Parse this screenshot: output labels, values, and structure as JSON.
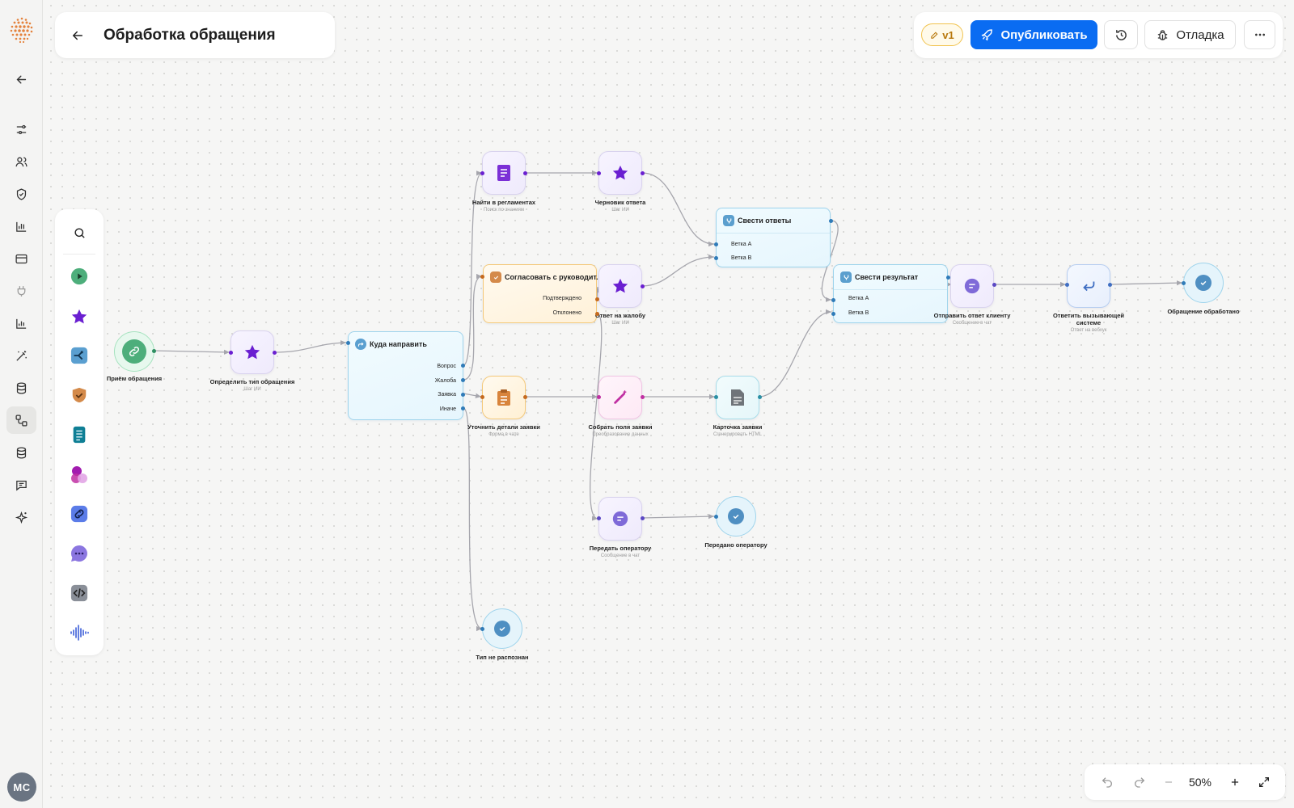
{
  "app": {
    "title": "Обработка обращения",
    "avatar_initials": "MC"
  },
  "toolbar": {
    "version": "v1",
    "publish": "Опубликовать",
    "history_icon": "history-icon",
    "debug": "Отладка",
    "more_icon": "more-icon"
  },
  "sidebar": {
    "items": [
      {
        "icon": "sliders-icon"
      },
      {
        "icon": "users-icon"
      },
      {
        "icon": "shield-icon"
      },
      {
        "icon": "bar-chart-icon"
      },
      {
        "icon": "card-icon"
      },
      {
        "icon": "plug-icon"
      },
      {
        "icon": "analytics-icon"
      },
      {
        "icon": "magic-wand-icon"
      },
      {
        "icon": "database-icon"
      },
      {
        "icon": "workflow-icon"
      },
      {
        "icon": "storage-icon"
      },
      {
        "icon": "chat-icon"
      },
      {
        "icon": "sparkle-icon"
      }
    ],
    "active": "workflow-icon"
  },
  "palette": {
    "items": [
      {
        "icon": "search-icon"
      },
      {
        "icon": "play-icon"
      },
      {
        "icon": "ai-star-icon"
      },
      {
        "icon": "branch-icon"
      },
      {
        "icon": "approval-shield-icon"
      },
      {
        "icon": "document-icon"
      },
      {
        "icon": "merge-circles-icon"
      },
      {
        "icon": "link-icon"
      },
      {
        "icon": "message-icon"
      },
      {
        "icon": "code-icon"
      },
      {
        "icon": "voice-icon"
      }
    ]
  },
  "nodes": {
    "n1": {
      "label": "Приём обращения",
      "sub": ""
    },
    "n2": {
      "label": "Определить тип обращения",
      "sub": "Шаг ИИ"
    },
    "router": {
      "title": "Куда направить",
      "outputs": [
        "Вопрос",
        "Жалоба",
        "Заявка",
        "Иначе"
      ]
    },
    "search": {
      "label": "Найти в регламентах",
      "sub": "Поиск по знаниям"
    },
    "draft": {
      "label": "Черновик ответа",
      "sub": "Шаг ИИ"
    },
    "approve": {
      "title": "Согласовать с руководит...",
      "outputs": [
        "Подтверждено",
        "Отклонено"
      ]
    },
    "complaint": {
      "label": "Ответ на жалобу",
      "sub": "Шаг ИИ"
    },
    "merge1": {
      "title": "Свести ответы",
      "inputs": [
        "Ветка A",
        "Ветка B"
      ]
    },
    "merge2": {
      "title": "Свести результат",
      "inputs": [
        "Ветка A",
        "Ветка B"
      ]
    },
    "details": {
      "label": "Уточнить детали заявки",
      "sub": "Форма в чате"
    },
    "collect": {
      "label": "Собрать поля заявки",
      "sub": "Преобразование данных"
    },
    "card": {
      "label": "Карточка заявки",
      "sub": "Сгенерировать HTML"
    },
    "reply": {
      "label": "Отправить ответ клиенту",
      "sub": "Сообщение в чат"
    },
    "webhook": {
      "label": "Ответить вызывающей системе",
      "sub": "Ответ на вебхук"
    },
    "done": {
      "label": "Обращение обработано",
      "sub": ""
    },
    "operator": {
      "label": "Передать оператору",
      "sub": "Сообщение в чат"
    },
    "op_done": {
      "label": "Передано оператору",
      "sub": ""
    },
    "unknown": {
      "label": "Тип не распознан",
      "sub": ""
    }
  },
  "zoom": {
    "value": "50%"
  },
  "colors": {
    "publish": "#0a6cf2",
    "ai": "#6a1fd1",
    "edge": "#a6a6ad"
  }
}
